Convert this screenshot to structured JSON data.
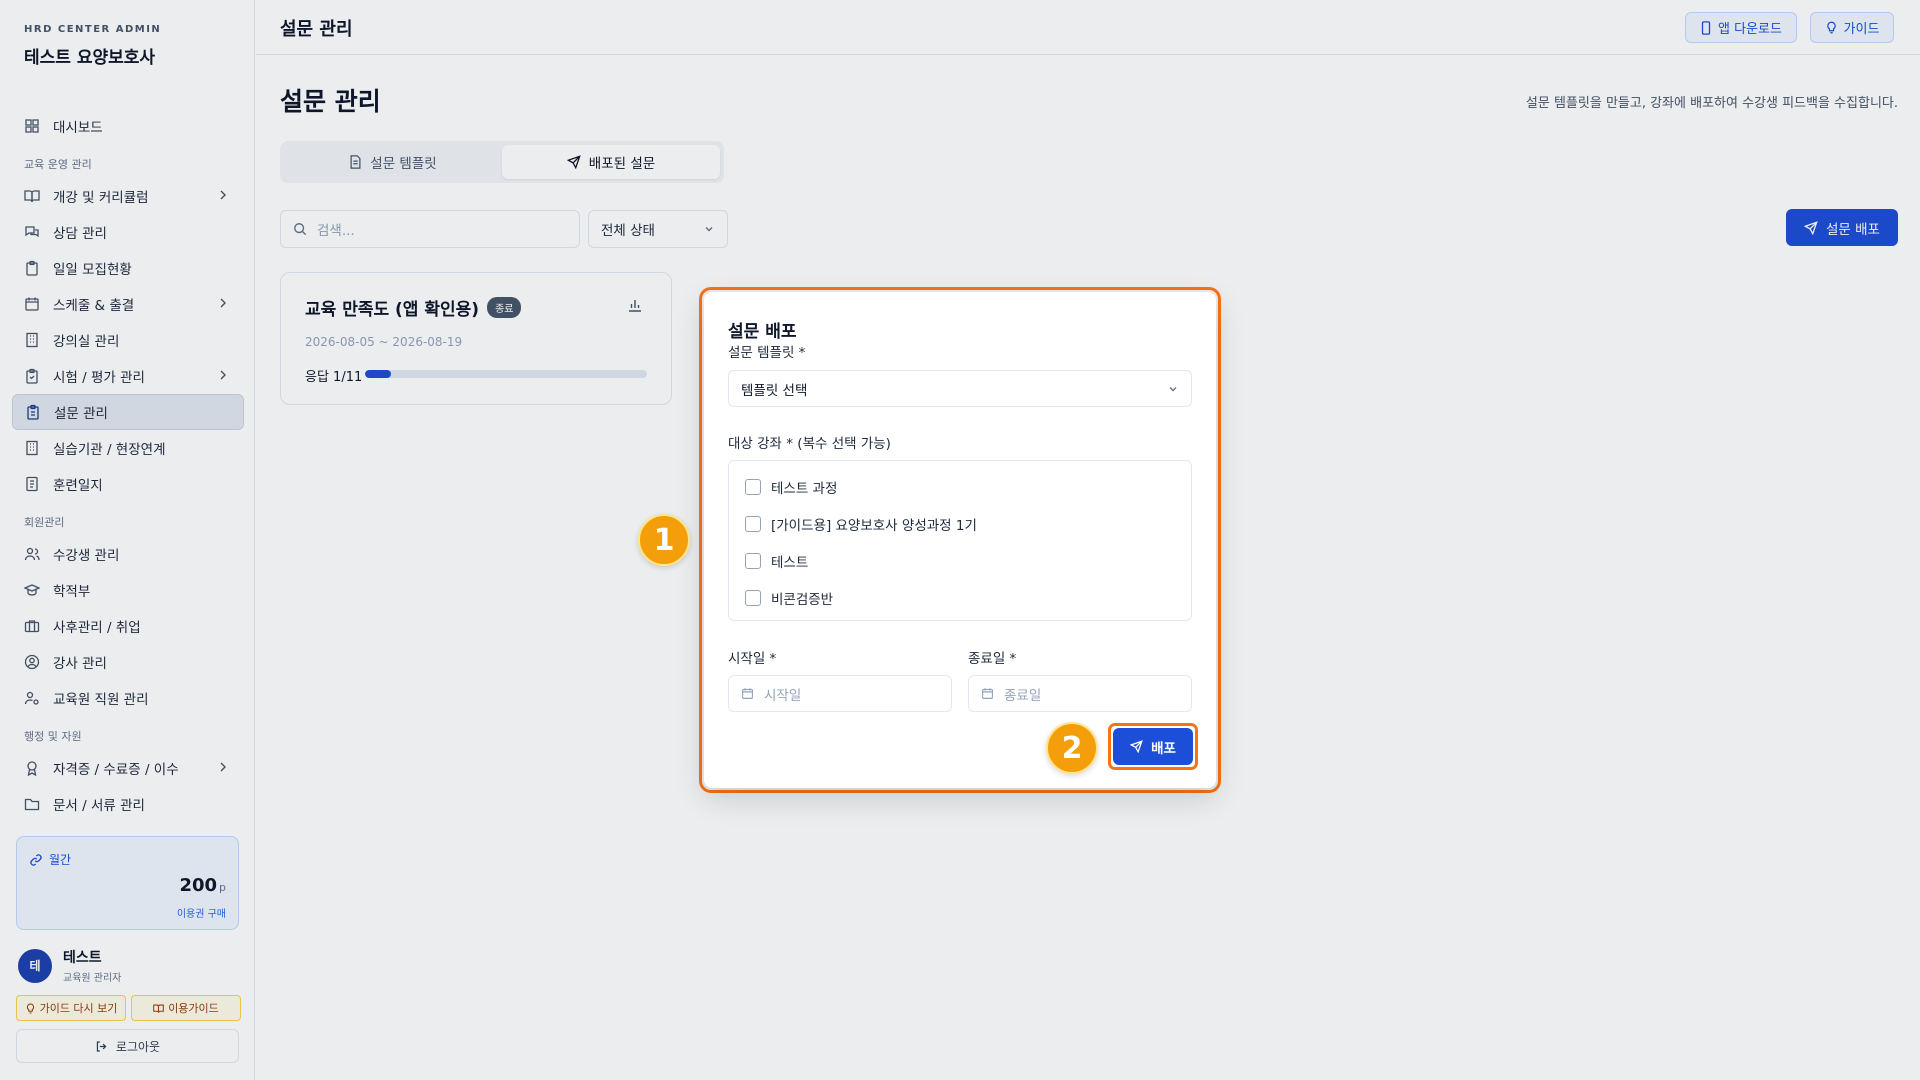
{
  "sidebar": {
    "brand_sub": "HRD CENTER ADMIN",
    "brand_title": "테스트 요양보호사",
    "items": [
      {
        "label": "대시보드"
      },
      {
        "section": "교육 운영 관리"
      },
      {
        "label": "개강 및 커리큘럼",
        "chevron": true
      },
      {
        "label": "상담 관리"
      },
      {
        "label": "일일 모집현황"
      },
      {
        "label": "스케줄 & 출결",
        "chevron": true
      },
      {
        "label": "강의실 관리"
      },
      {
        "label": "시험 / 평가 관리",
        "chevron": true
      },
      {
        "label": "설문 관리",
        "active": true
      },
      {
        "label": "실습기관 / 현장연계"
      },
      {
        "label": "훈련일지"
      },
      {
        "section": "회원관리"
      },
      {
        "label": "수강생 관리"
      },
      {
        "label": "학적부"
      },
      {
        "label": "사후관리 / 취업"
      },
      {
        "label": "강사 관리"
      },
      {
        "label": "교육원 직원 관리"
      },
      {
        "section": "행정 및 자원"
      },
      {
        "label": "자격증 / 수료증 / 이수",
        "chevron": true
      },
      {
        "label": "문서 / 서류 관리"
      }
    ],
    "plan": {
      "label": "월간",
      "value": "200",
      "unit": "p",
      "link": "이용권 구매"
    },
    "user": {
      "initial": "테",
      "name": "테스트",
      "role": "교육원 관리자"
    },
    "guide_again": "가이드 다시 보기",
    "usage_guide": "이용가이드",
    "logout": "로그아웃"
  },
  "topbar": {
    "title": "설문 관리",
    "app_download": "앱 다운로드",
    "guide": "가이드"
  },
  "main": {
    "title": "설문 관리",
    "description": "설문 템플릿을 만들고, 강좌에 배포하여 수강생 피드백을 수집합니다.",
    "tabs": [
      {
        "label": "설문 템플릿",
        "active": false
      },
      {
        "label": "배포된 설문",
        "active": true
      }
    ],
    "search_placeholder": "검색...",
    "status_filter": "전체 상태",
    "deploy_button": "설문 배포",
    "survey_card": {
      "title": "교육 만족도 (앱 확인용)",
      "badge": "종료",
      "dates": "2026-08-05 ~ 2026-08-19",
      "response_label": "응답 1/11",
      "response_ratio": 0.0909
    }
  },
  "modal": {
    "title": "설문 배포",
    "template_label": "설문 템플릿 *",
    "template_value": "템플릿 선택",
    "courses_label": "대상 강좌 * (복수 선택 가능)",
    "courses": [
      "테스트 과정",
      "[가이드용] 요양보호사 양성과정 1기",
      "테스트",
      "비콘검증반"
    ],
    "start_label": "시작일 *",
    "start_placeholder": "시작일",
    "end_label": "종료일 *",
    "end_placeholder": "종료일",
    "deploy_button": "배포"
  },
  "annotations": {
    "step1": "1",
    "step2": "2",
    "highlight_color": "#f97316",
    "marker_color": "#f59e0b"
  },
  "colors": {
    "primary": "#1d4ed8",
    "badge_gray": "#475569"
  }
}
